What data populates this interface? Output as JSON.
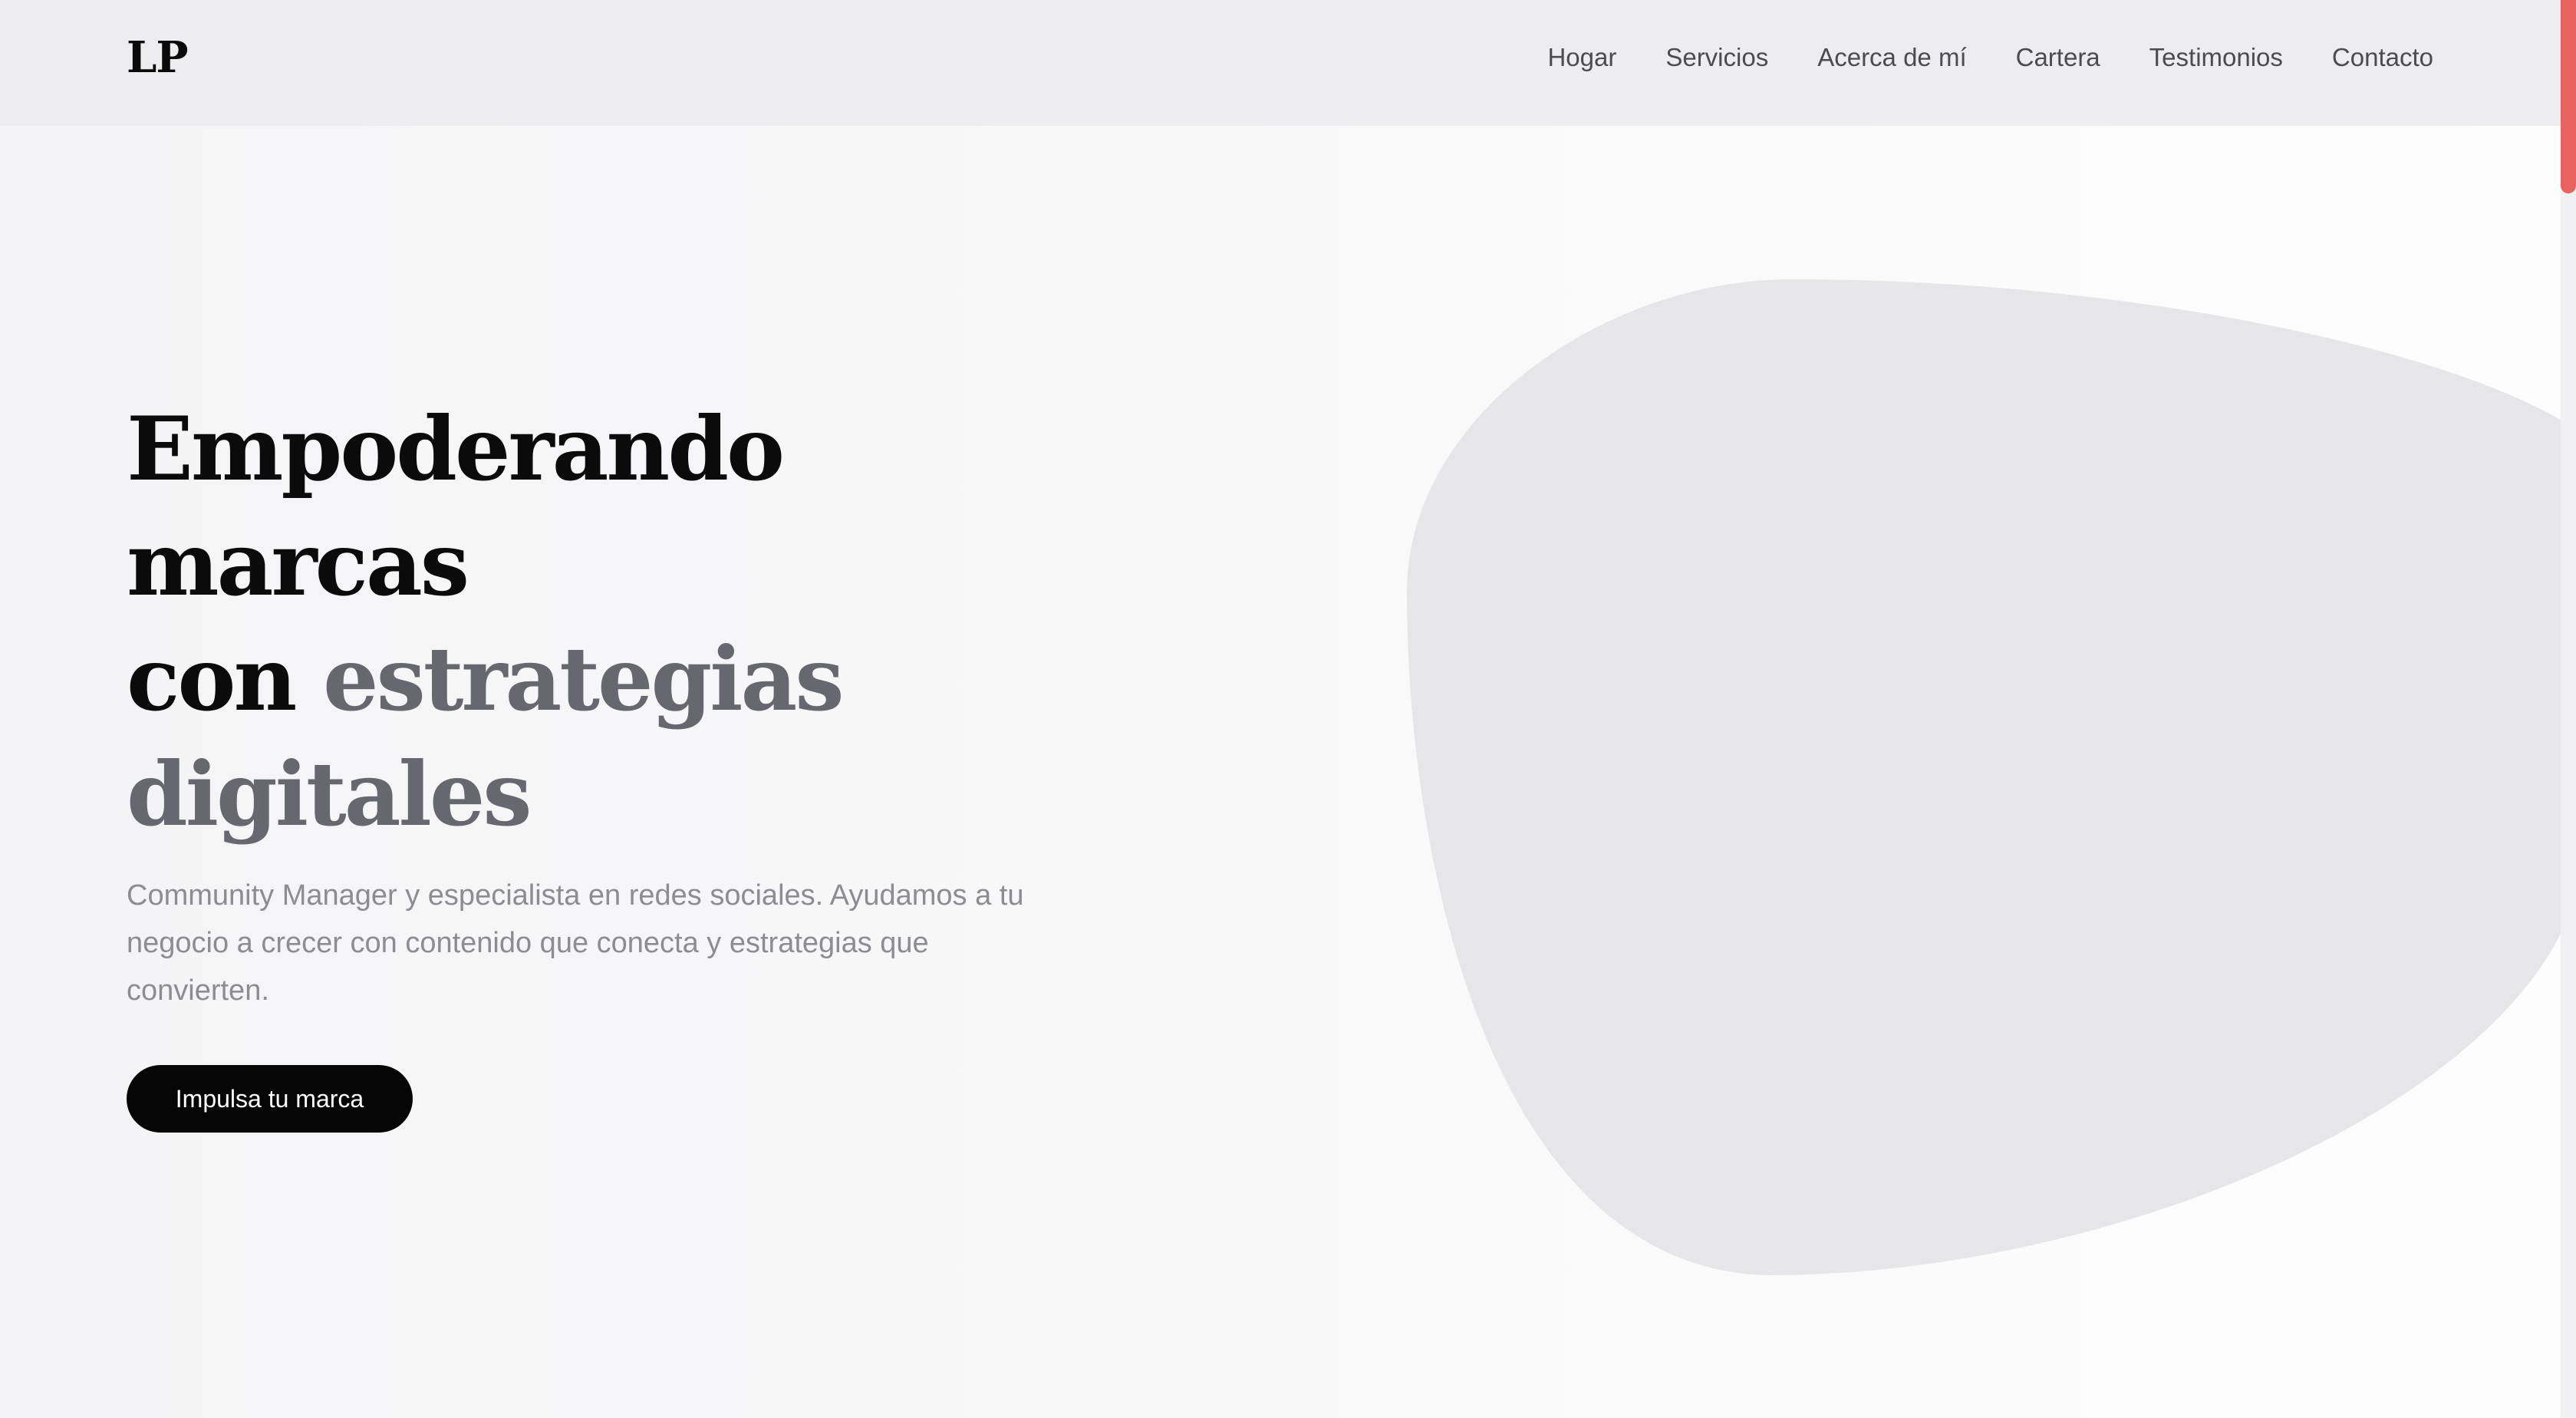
{
  "header": {
    "logo": "LP",
    "nav": [
      {
        "label": "Hogar"
      },
      {
        "label": "Servicios"
      },
      {
        "label": "Acerca de mí"
      },
      {
        "label": "Cartera"
      },
      {
        "label": "Testimonios"
      },
      {
        "label": "Contacto"
      }
    ]
  },
  "hero": {
    "title_line1": "Empoderando marcas",
    "title_con": "con",
    "title_accent1": "estrategias",
    "title_accent2": "digitales",
    "subtitle": "Community Manager y especialista en redes sociales. Ayudamos a tu negocio a crecer con contenido que conecta y estrategias que convierten.",
    "cta_label": "Impulsa tu marca"
  },
  "colors": {
    "nav_background": "#ededef",
    "title": "#0b0b0c",
    "title_accent": "#67676f",
    "subtitle": "#8c8c93",
    "button_background": "#050505",
    "blob": "#e6e6e8",
    "scrollbar_thumb": "#e8625f"
  }
}
